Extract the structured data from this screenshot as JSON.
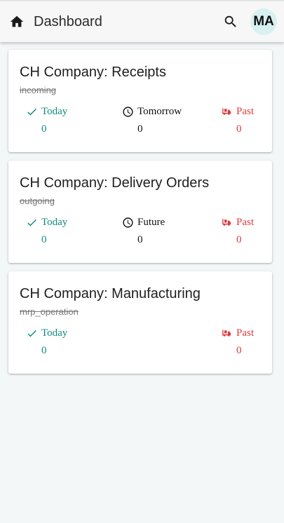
{
  "header": {
    "title": "Dashboard",
    "avatar_initials": "MA"
  },
  "cards": [
    {
      "title": "CH Company: Receipts",
      "subtitle": "incoming",
      "today_label": "Today",
      "today_count": "0",
      "mid_label": "Tomorrow",
      "mid_count": "0",
      "past_label": "Past",
      "past_count": "0"
    },
    {
      "title": "CH Company: Delivery Orders",
      "subtitle": "outgoing",
      "today_label": "Today",
      "today_count": "0",
      "mid_label": "Future",
      "mid_count": "0",
      "past_label": "Past",
      "past_count": "0"
    },
    {
      "title": "CH Company: Manufacturing",
      "subtitle": "mrp_operation",
      "today_label": "Today",
      "today_count": "0",
      "past_label": "Past",
      "past_count": "0"
    }
  ],
  "colors": {
    "today": "#0e8a7e",
    "past": "#e0393b",
    "avatar_bg": "#d9f0f1",
    "background": "#f3f7f7"
  },
  "icons": {
    "header": [
      "home-icon",
      "search-icon"
    ],
    "stats": [
      "check-icon",
      "clock-icon",
      "overdue-truck-icon"
    ]
  }
}
